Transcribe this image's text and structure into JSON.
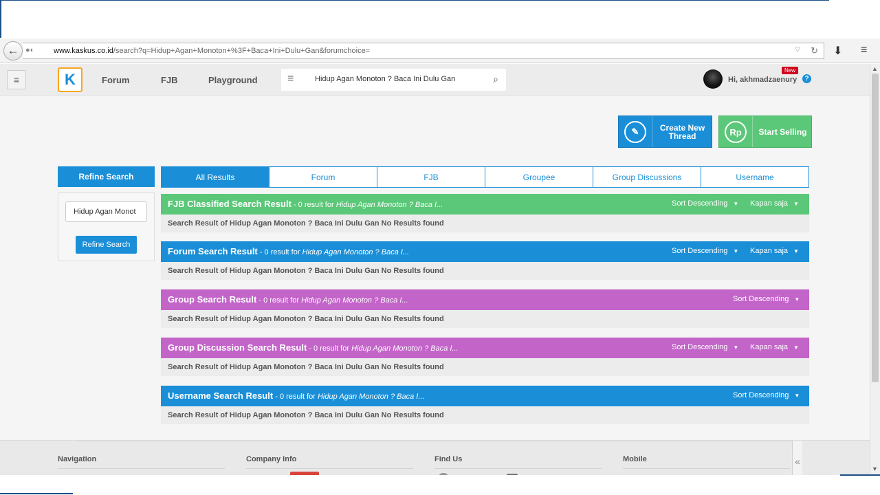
{
  "browser": {
    "url_domain": "www.kaskus.co.id",
    "url_path": "/search?q=Hidup+Agan+Monoton+%3F+Baca+Ini+Dulu+Gan&forumchoice="
  },
  "header": {
    "logo": "K",
    "nav": [
      "Forum",
      "FJB",
      "Playground"
    ],
    "search_value": "Hidup Agan Monoton ? Baca Ini Dulu Gan",
    "greeting": "Hi, akhmadzaenury",
    "new_badge": "New",
    "help": "?"
  },
  "actions": {
    "create_icon": "✎",
    "create_label": "Create New Thread",
    "sell_icon": "Rp",
    "sell_label": "Start Selling"
  },
  "refine": {
    "title": "Refine Search",
    "input_value": "Hidup Agan Monot",
    "button": "Refine Search"
  },
  "tabs": [
    "All Results",
    "Forum",
    "FJB",
    "Groupee",
    "Group Discussions",
    "Username"
  ],
  "sections": [
    {
      "title": "FJB Classified Search Result",
      "meta": " - 0 result for ",
      "query": "Hidup Agan Monoton ? Baca I...",
      "sort": "Sort Descending",
      "time": "Kapan saja",
      "body": "Search Result of Hidup Agan Monoton ? Baca Ini Dulu Gan No Results found"
    },
    {
      "title": "Forum Search Result",
      "meta": " - 0 result for ",
      "query": "Hidup Agan Monoton ? Baca I...",
      "sort": "Sort Descending",
      "time": "Kapan saja",
      "body": "Search Result of Hidup Agan Monoton ? Baca Ini Dulu Gan No Results found"
    },
    {
      "title": "Group Search Result",
      "meta": " - 0 result for ",
      "query": "Hidup Agan Monoton ? Baca I...",
      "sort": "Sort Descending",
      "body": "Search Result of Hidup Agan Monoton ? Baca Ini Dulu Gan No Results found"
    },
    {
      "title": "Group Discussion Search Result",
      "meta": " - 0 result for ",
      "query": "Hidup Agan Monoton ? Baca I...",
      "sort": "Sort Descending",
      "time": "Kapan saja",
      "body": "Search Result of Hidup Agan Monoton ? Baca Ini Dulu Gan No Results found"
    },
    {
      "title": "Username Search Result",
      "meta": " - 0 result for ",
      "query": "Hidup Agan Monoton ? Baca I...",
      "sort": "Sort Descending",
      "body": "Search Result of Hidup Agan Monoton ? Baca Ini Dulu Gan No Results found"
    }
  ],
  "footer": {
    "columns": [
      "Navigation",
      "Company Info",
      "Find Us",
      "Mobile"
    ],
    "collapse": "«"
  },
  "colors": {
    "primary_blue": "#1a8fd8",
    "green": "#5bc778",
    "purple": "#c364c9",
    "new_red": "#d0021b",
    "logo_orange": "#f5a623"
  }
}
